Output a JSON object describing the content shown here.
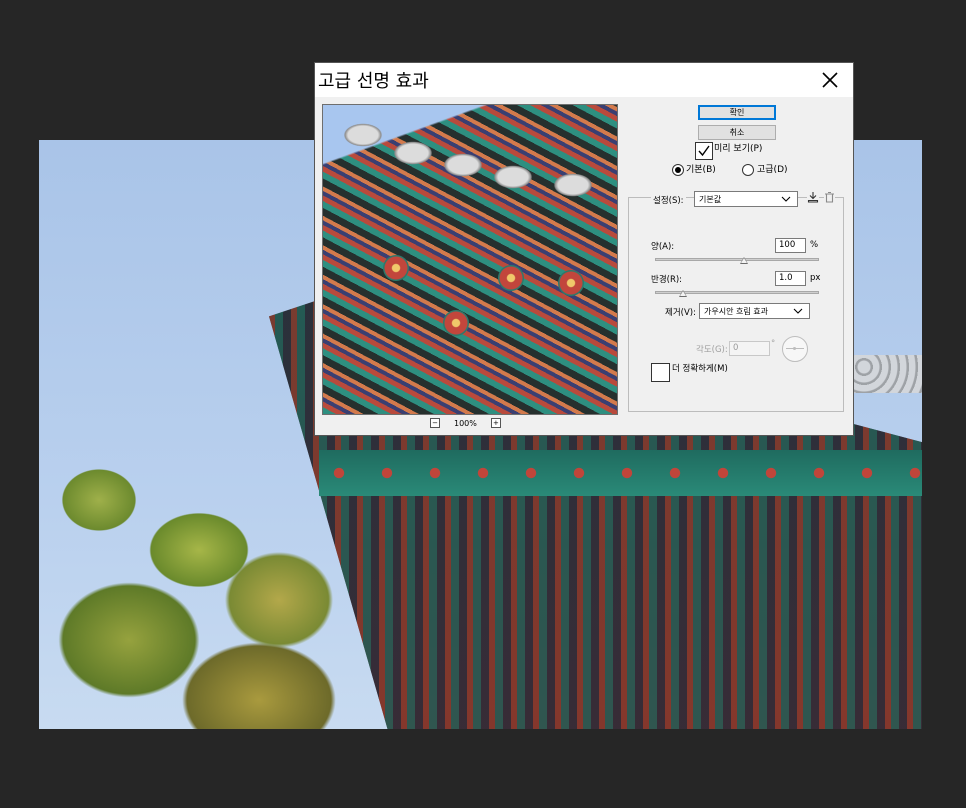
{
  "dialog": {
    "title": "고급 선명 효과",
    "ok_label": "확인",
    "cancel_label": "취소",
    "preview_label": "미리 보기(P)",
    "preview_checked": true,
    "mode_basic_label": "기본(B)",
    "mode_advanced_label": "고급(D)",
    "mode_selected": "basic",
    "zoom_level": "100%",
    "zoom_out_symbol": "−",
    "zoom_in_symbol": "+",
    "settings_label": "설정(S):",
    "settings_value": "기본값",
    "amount_label": "양(A):",
    "amount_value": "100",
    "amount_unit": "%",
    "amount_slider_fraction": 0.545,
    "radius_label": "반경(R):",
    "radius_value": "1.0",
    "radius_unit": "px",
    "radius_slider_fraction": 0.17,
    "remove_label": "제거(V):",
    "remove_value": "가우시안 흐림 효과",
    "angle_label": "각도(G):",
    "angle_value": "0",
    "angle_unit": "°",
    "more_accurate_label": "더 정확하게(M)",
    "more_accurate_checked": false
  },
  "icons": {
    "close": "close-icon",
    "save_preset": "save-preset-icon",
    "delete_preset": "trash-icon"
  }
}
